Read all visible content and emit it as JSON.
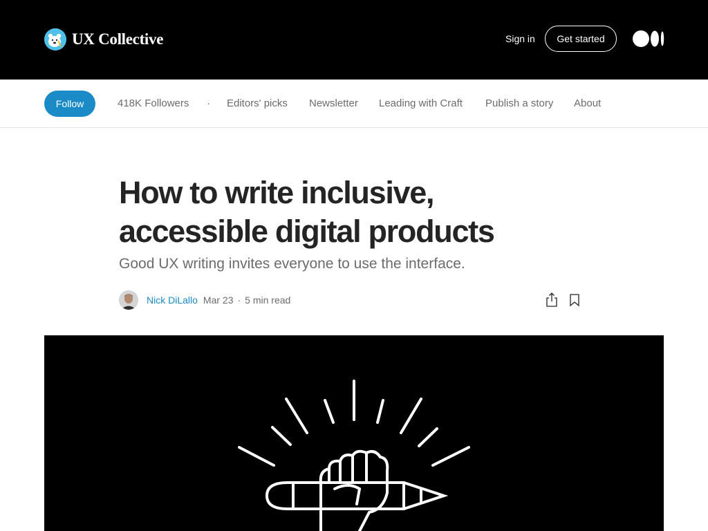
{
  "header": {
    "publication_name": "UX Collective",
    "signin_label": "Sign in",
    "get_started_label": "Get started",
    "logo_icon": "polar-bear-logo-icon",
    "medium_icon": "medium-logo-icon"
  },
  "pubnav": {
    "follow_label": "Follow",
    "followers": "418K Followers",
    "dot": "·",
    "items": [
      "Editors' picks",
      "Newsletter",
      "Leading with Craft",
      "Publish a story",
      "About"
    ]
  },
  "article": {
    "title": "How to write inclusive, accessible digital products",
    "subtitle": "Good UX writing invites everyone to use the interface.",
    "author": "Nick DiLallo",
    "date": "Mar 23",
    "separator": "·",
    "read_time": "5 min read"
  },
  "icons": {
    "share": "share-icon",
    "bookmark": "bookmark-icon",
    "hero": "fist-holding-pencil-illustration"
  },
  "colors": {
    "accent": "#1a8bc7",
    "header_bg": "#000000",
    "text": "#242424",
    "muted": "#6b6b6b"
  }
}
